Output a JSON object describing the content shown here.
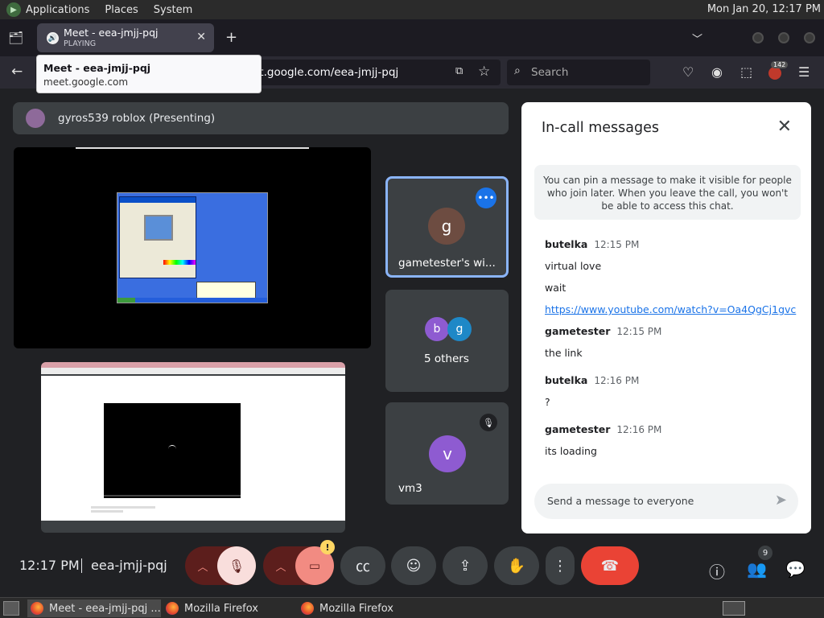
{
  "topbar": {
    "applications": "Applications",
    "places": "Places",
    "system": "System",
    "clock": "Mon Jan 20, 12:17 PM"
  },
  "browser": {
    "tab_title": "Meet - eea-jmjj-pqj",
    "tab_status": "PLAYING",
    "url_dim": "",
    "url_main": "et.google.com/eea-jmjj-pqj",
    "search_placeholder": "Search",
    "extension_badge": "142",
    "tooltip_title": "Meet - eea-jmjj-pqj",
    "tooltip_host": "meet.google.com"
  },
  "meet": {
    "presenter_label": "gyros539 roblox (Presenting)",
    "tiles": [
      {
        "avatar": "g",
        "label": "gametester's wi...",
        "color": "#6d4c41"
      },
      {
        "avatar": "",
        "label": "5 others"
      },
      {
        "avatar": "v",
        "label": "vm3",
        "color": "#8e5bd1"
      }
    ],
    "others_avatars": [
      {
        "letter": "b",
        "color": "#8e5bd1"
      },
      {
        "letter": "g",
        "color": "#1e88c7"
      }
    ],
    "meeting_time": "12:17 PM",
    "meeting_code": "eea-jmjj-pqj",
    "people_count": "9",
    "warning_mark": "!"
  },
  "chat": {
    "title": "In-call messages",
    "pin_notice": "You can pin a message to make it visible for people who join later. When you leave the call, you won't be able to access this chat.",
    "groups": [
      {
        "sender": "butelka",
        "time": "12:15 PM",
        "messages": [
          "virtual love",
          "wait"
        ],
        "link": "https://www.youtube.com/watch?v=Oa4QgCj1gvc"
      },
      {
        "sender": "gametester",
        "time": "12:15 PM",
        "messages": [
          "the link"
        ]
      },
      {
        "sender": "butelka",
        "time": "12:16 PM",
        "messages": [
          "?"
        ]
      },
      {
        "sender": "gametester",
        "time": "12:16 PM",
        "messages": [
          "its loading"
        ]
      }
    ],
    "input_placeholder": "Send a message to everyone"
  },
  "taskbar": {
    "items": [
      "Meet - eea-jmjj-pqj ...",
      "Mozilla Firefox",
      "Mozilla Firefox"
    ]
  },
  "colors": {
    "accent_blue": "#1a73e8",
    "hangup_red": "#ea4335",
    "meet_bg": "#202124",
    "tile_bg": "#3c4043"
  }
}
